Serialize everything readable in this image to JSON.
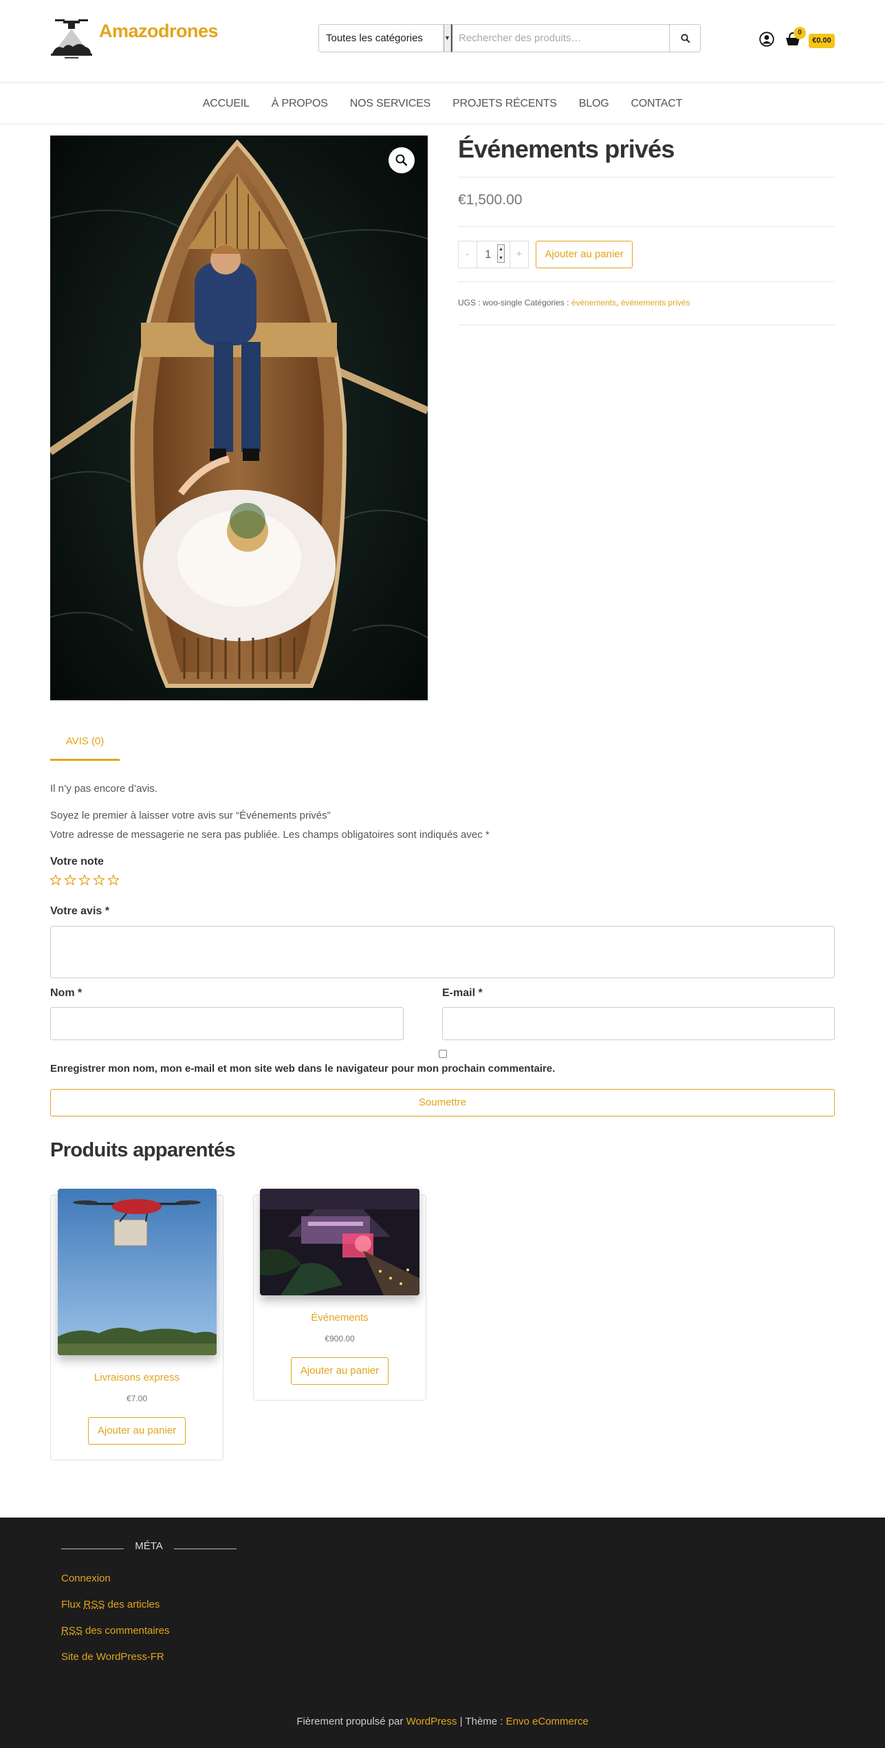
{
  "header": {
    "site_title": "Amazodrones",
    "category_select_value": "Toutes les catégories",
    "search_placeholder": "Rechercher des produits…",
    "cart_count": "0",
    "cart_total": "€0.00"
  },
  "nav": {
    "items": [
      "ACCUEIL",
      "À PROPOS",
      "NOS SERVICES",
      "PROJETS RÉCENTS",
      "BLOG",
      "CONTACT"
    ]
  },
  "product": {
    "title": "Événements privés",
    "price": "€1,500.00",
    "qty_minus": "-",
    "qty_value": "1",
    "qty_plus": "+",
    "add_to_cart": "Ajouter au panier",
    "meta_sku_label": "UGS : woo-single",
    "meta_cat_label": "Catégories :",
    "meta_cat_1": "événements",
    "meta_cat_sep": ",",
    "meta_cat_2": "événements privés"
  },
  "reviews": {
    "tab_label": "AVIS (0)",
    "no_reviews": "Il n’y pas encore d’avis.",
    "be_first": "Soyez le premier à laisser votre avis sur “Événements privés”",
    "email_note": "Votre adresse de messagerie ne sera pas publiée. Les champs obligatoires sont indiqués avec *",
    "rating_label": "Votre note",
    "review_label": "Votre avis",
    "name_label": "Nom",
    "email_label": "E-mail",
    "required_mark": "*",
    "save_info": "Enregistrer mon nom, mon e-mail et mon site web dans le navigateur pour mon prochain commentaire.",
    "submit": "Soumettre"
  },
  "related": {
    "title": "Produits apparentés",
    "products": [
      {
        "name": "Livraisons express",
        "price": "€7.00",
        "button": "Ajouter au panier"
      },
      {
        "name": "Événements",
        "price": "€900.00",
        "button": "Ajouter au panier"
      }
    ]
  },
  "footer": {
    "widget_title": "MÉTA",
    "links": {
      "login": "Connexion",
      "feed_pre": "Flux ",
      "feed_abbr": "RSS",
      "feed_post": " des articles",
      "comments_abbr": "RSS",
      "comments_post": " des commentaires",
      "wp": "Site de WordPress-FR"
    },
    "credit_pre": "Fièrement propulsé par ",
    "credit_wp": "WordPress",
    "credit_mid": " | Thème : ",
    "credit_theme": "Envo eCommerce"
  },
  "colors": {
    "accent": "#e3a41c",
    "badge": "#f5c518",
    "footer_bg": "#1c1c1c"
  },
  "icons": [
    "drone-logo-icon",
    "caret-down-icon",
    "search-icon",
    "user-icon",
    "cart-icon",
    "zoom-icon",
    "star-icon"
  ]
}
